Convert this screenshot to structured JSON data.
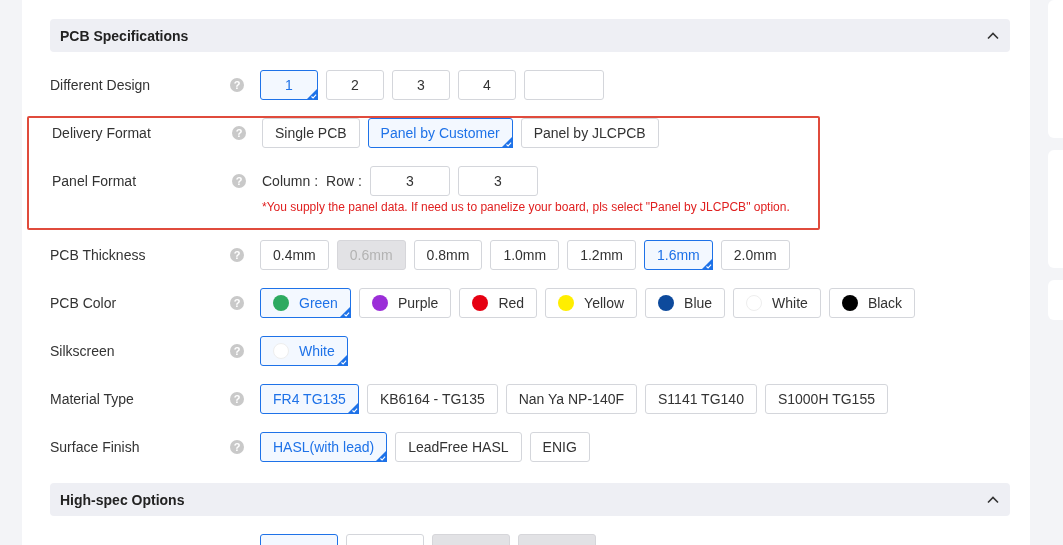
{
  "sections": [
    {
      "title": "PCB Specifications",
      "expanded": true,
      "rows": [
        {
          "label": "Different Design",
          "help": "?",
          "highlighted": false,
          "kind": "options",
          "options": [
            {
              "kind": "option",
              "label": "1",
              "selected": true,
              "disabled": false
            },
            {
              "kind": "option",
              "label": "2",
              "selected": false,
              "disabled": false
            },
            {
              "kind": "option",
              "label": "3",
              "selected": false,
              "disabled": false
            },
            {
              "kind": "option",
              "label": "4",
              "selected": false,
              "disabled": false
            },
            {
              "kind": "input"
            }
          ]
        },
        {
          "label": "Delivery Format",
          "help": "?",
          "highlighted": true,
          "kind": "options",
          "options": [
            {
              "kind": "option",
              "label": "Single PCB",
              "selected": false,
              "disabled": false
            },
            {
              "kind": "option",
              "label": "Panel by Customer",
              "selected": true,
              "disabled": false
            },
            {
              "kind": "option",
              "label": "Panel by JLCPCB",
              "selected": false,
              "disabled": false
            }
          ]
        },
        {
          "label": "Panel Format",
          "help": "?",
          "highlighted": true,
          "kind": "panel",
          "column_label": "Column :",
          "row_label": "Row :",
          "column_value": "3",
          "row_value": "3",
          "note": "*You supply the panel data. If need us to panelize your board, pls select \"Panel by JLCPCB\" option."
        },
        {
          "label": "PCB Thickness",
          "help": "?",
          "highlighted": false,
          "kind": "options",
          "options": [
            {
              "kind": "option",
              "label": "0.4mm",
              "selected": false,
              "disabled": false
            },
            {
              "kind": "option",
              "label": "0.6mm",
              "selected": false,
              "disabled": true
            },
            {
              "kind": "option",
              "label": "0.8mm",
              "selected": false,
              "disabled": false
            },
            {
              "kind": "option",
              "label": "1.0mm",
              "selected": false,
              "disabled": false
            },
            {
              "kind": "option",
              "label": "1.2mm",
              "selected": false,
              "disabled": false
            },
            {
              "kind": "option",
              "label": "1.6mm",
              "selected": true,
              "disabled": false
            },
            {
              "kind": "option",
              "label": "2.0mm",
              "selected": false,
              "disabled": false
            }
          ]
        },
        {
          "label": "PCB Color",
          "help": "?",
          "highlighted": false,
          "kind": "options",
          "options": [
            {
              "kind": "option",
              "label": "Green",
              "selected": true,
              "disabled": false,
              "color": "#2daa60"
            },
            {
              "kind": "option",
              "label": "Purple",
              "selected": false,
              "disabled": false,
              "color": "#9b2ed8"
            },
            {
              "kind": "option",
              "label": "Red",
              "selected": false,
              "disabled": false,
              "color": "#e60012"
            },
            {
              "kind": "option",
              "label": "Yellow",
              "selected": false,
              "disabled": false,
              "color": "#ffee00"
            },
            {
              "kind": "option",
              "label": "Blue",
              "selected": false,
              "disabled": false,
              "color": "#0d4a9c"
            },
            {
              "kind": "option",
              "label": "White",
              "selected": false,
              "disabled": false,
              "color": "#ffffff"
            },
            {
              "kind": "option",
              "label": "Black",
              "selected": false,
              "disabled": false,
              "color": "#000000"
            }
          ]
        },
        {
          "label": "Silkscreen",
          "help": "?",
          "highlighted": false,
          "kind": "options",
          "options": [
            {
              "kind": "option",
              "label": "White",
              "selected": true,
              "disabled": false,
              "color": "#ffffff"
            }
          ]
        },
        {
          "label": "Material Type",
          "help": "?",
          "highlighted": false,
          "kind": "options",
          "options": [
            {
              "kind": "option",
              "label": "FR4 TG135",
              "selected": true,
              "disabled": false
            },
            {
              "kind": "option",
              "label": "KB6164 - TG135",
              "selected": false,
              "disabled": false
            },
            {
              "kind": "option",
              "label": "Nan Ya NP-140F",
              "selected": false,
              "disabled": false
            },
            {
              "kind": "option",
              "label": "S1141 TG140",
              "selected": false,
              "disabled": false
            },
            {
              "kind": "option",
              "label": "S1000H TG155",
              "selected": false,
              "disabled": false
            }
          ]
        },
        {
          "label": "Surface Finish",
          "help": "?",
          "highlighted": false,
          "kind": "options",
          "options": [
            {
              "kind": "option",
              "label": "HASL(with lead)",
              "selected": true,
              "disabled": false
            },
            {
              "kind": "option",
              "label": "LeadFree HASL",
              "selected": false,
              "disabled": false
            },
            {
              "kind": "option",
              "label": "ENIG",
              "selected": false,
              "disabled": false
            }
          ]
        }
      ]
    },
    {
      "title": "High-spec Options",
      "expanded": true,
      "rows": [
        {
          "highlighted": false,
          "kind": "options",
          "options": [
            {
              "kind": "option",
              "selected": true,
              "disabled": false
            },
            {
              "kind": "option",
              "selected": false,
              "disabled": false
            },
            {
              "kind": "option",
              "selected": false,
              "disabled": true
            },
            {
              "kind": "option",
              "selected": false,
              "disabled": true
            }
          ]
        }
      ]
    }
  ]
}
